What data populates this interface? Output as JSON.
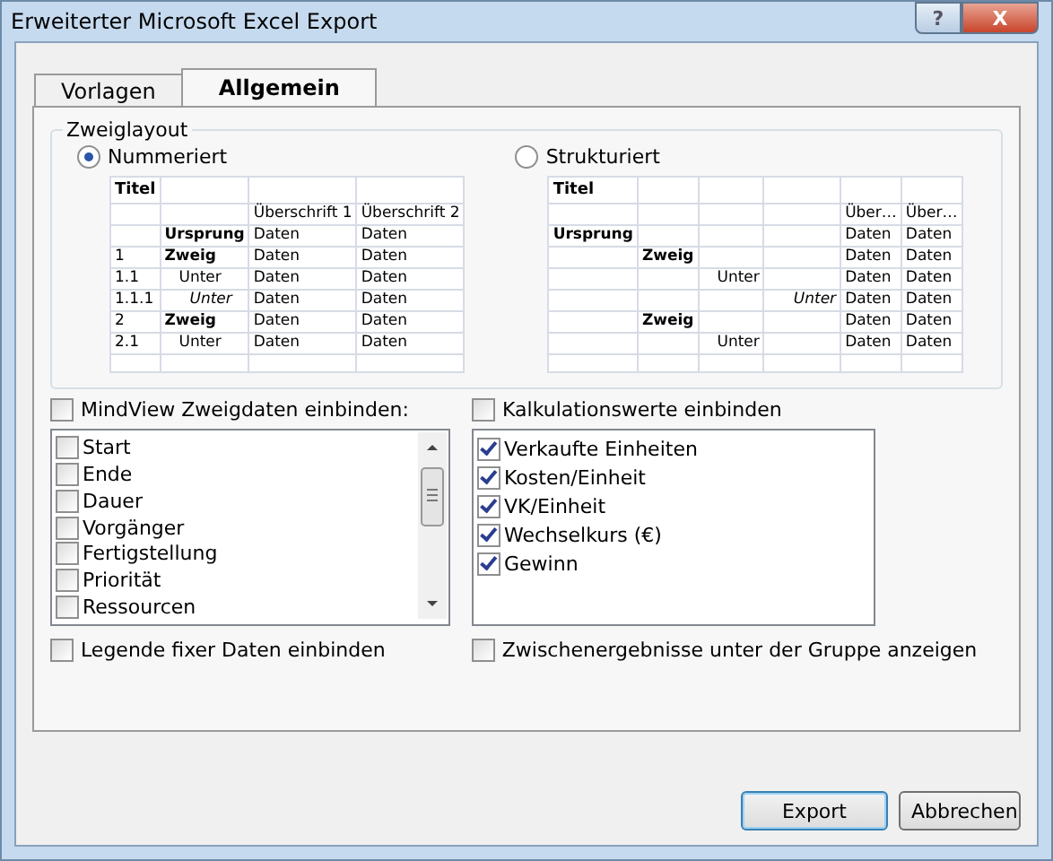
{
  "window": {
    "title": "Erweiterter Microsoft Excel Export",
    "help_button": "?",
    "close_button": "X"
  },
  "tabs": [
    {
      "label": "Vorlagen",
      "selected": false
    },
    {
      "label": "Allgemein",
      "selected": true
    }
  ],
  "branch_layout": {
    "title": "Zweiglayout",
    "options": [
      {
        "label": "Nummeriert",
        "selected": true,
        "preview": {
          "rows": [
            {
              "kind": "title",
              "cells": [
                "Titel"
              ]
            },
            {
              "kind": "header",
              "cells": [
                null,
                null,
                "Überschrift 1",
                "Überschrift 2"
              ]
            },
            {
              "kind": "root",
              "cells": [
                null,
                "Ursprung",
                "Daten",
                "Daten"
              ]
            },
            {
              "kind": "branch",
              "cells": [
                "1",
                "Zweig",
                "Daten",
                "Daten"
              ]
            },
            {
              "kind": "sub",
              "cells": [
                "1.1",
                "Unter",
                "Daten",
                "Daten"
              ]
            },
            {
              "kind": "subsub",
              "cells": [
                "1.1.1",
                "Unter",
                "Daten",
                "Daten"
              ]
            },
            {
              "kind": "branch",
              "cells": [
                "2",
                "Zweig",
                "Daten",
                "Daten"
              ]
            },
            {
              "kind": "sub",
              "cells": [
                "2.1",
                "Unter",
                "Daten",
                "Daten"
              ]
            },
            {
              "kind": "blank",
              "cells": []
            }
          ]
        }
      },
      {
        "label": "Strukturiert",
        "selected": false,
        "preview": {
          "rows": [
            {
              "kind": "title",
              "cells": [
                "Titel"
              ]
            },
            {
              "kind": "header",
              "cells": [
                null,
                null,
                null,
                null,
                "Über…",
                "Über…"
              ]
            },
            {
              "kind": "root",
              "cells": [
                "Ursprung",
                null,
                null,
                null,
                "Daten",
                "Daten"
              ]
            },
            {
              "kind": "branch",
              "cells": [
                null,
                "Zweig",
                null,
                null,
                "Daten",
                "Daten"
              ]
            },
            {
              "kind": "sub",
              "cells": [
                null,
                null,
                "Unter",
                null,
                "Daten",
                "Daten"
              ]
            },
            {
              "kind": "subsub",
              "cells": [
                null,
                null,
                null,
                "Unter",
                "Daten",
                "Daten"
              ]
            },
            {
              "kind": "branch",
              "cells": [
                null,
                "Zweig",
                null,
                null,
                "Daten",
                "Daten"
              ]
            },
            {
              "kind": "sub",
              "cells": [
                null,
                null,
                "Unter",
                null,
                "Daten",
                "Daten"
              ]
            },
            {
              "kind": "blank",
              "cells": []
            }
          ]
        }
      }
    ]
  },
  "lists": [
    {
      "label": "MindView Zweigdaten einbinden:",
      "checked": false,
      "scrollable": true,
      "items": [
        {
          "label": "Start",
          "checked": false
        },
        {
          "label": "Ende",
          "checked": false
        },
        {
          "label": "Dauer",
          "checked": false
        },
        {
          "label": "Vorgänger",
          "checked": false
        },
        {
          "label": "Fertigstellung",
          "checked": false
        },
        {
          "label": "Priorität",
          "checked": false
        },
        {
          "label": "Ressourcen",
          "checked": false
        }
      ]
    },
    {
      "label": "Kalkulationswerte einbinden",
      "checked": false,
      "scrollable": false,
      "items": [
        {
          "label": "Verkaufte Einheiten",
          "checked": true
        },
        {
          "label": "Kosten/Einheit",
          "checked": true
        },
        {
          "label": "VK/Einheit",
          "checked": true
        },
        {
          "label": "Wechselkurs (€)",
          "checked": true
        },
        {
          "label": "Gewinn",
          "checked": true
        }
      ]
    }
  ],
  "options": [
    {
      "label": "Legende fixer Daten einbinden",
      "checked": false
    },
    {
      "label": "Zwischenergebnisse unter der Gruppe anzeigen",
      "checked": false
    }
  ],
  "buttons": [
    {
      "label": "Export",
      "default": true
    },
    {
      "label": "Abbrechen",
      "default": false
    }
  ]
}
